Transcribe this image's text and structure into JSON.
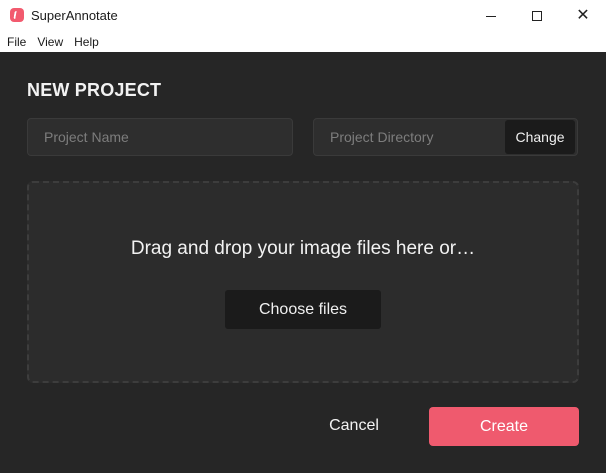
{
  "window": {
    "title": "SuperAnnotate",
    "app_icon": "superannotate-logo-icon",
    "controls": {
      "minimize_icon": "minimize-icon",
      "maximize_icon": "maximize-icon",
      "close_icon": "close-icon",
      "close_glyph": "✕"
    }
  },
  "menu": {
    "items": [
      {
        "label": "File"
      },
      {
        "label": "View"
      },
      {
        "label": "Help"
      }
    ]
  },
  "dialog": {
    "heading": "NEW PROJECT",
    "project_name": {
      "placeholder": "Project Name",
      "value": ""
    },
    "project_directory": {
      "placeholder": "Project Directory",
      "value": ""
    },
    "change_label": "Change",
    "dropzone": {
      "text": "Drag and drop your image files here or…",
      "choose_label": "Choose files"
    },
    "cancel_label": "Cancel",
    "create_label": "Create"
  },
  "colors": {
    "background": "#262626",
    "accent": "#ef5a6e",
    "button_dark": "#1b1b1b"
  }
}
